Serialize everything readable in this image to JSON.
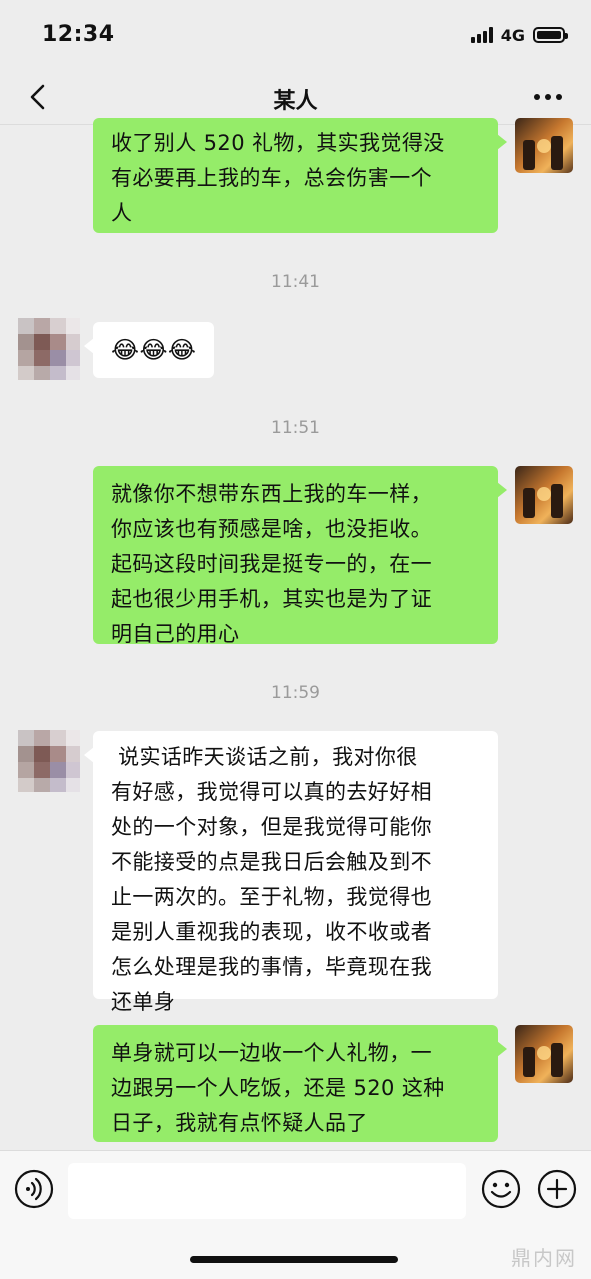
{
  "status_bar": {
    "time": "12:34",
    "network": "4G"
  },
  "nav": {
    "title": "某人"
  },
  "messages": [
    {
      "side": "out",
      "text": "收了别人 520 礼物，其实我觉得没\n有必要再上我的车，总会伤害一个\n人"
    },
    {
      "timestamp": "11:41"
    },
    {
      "side": "in",
      "text": "😂😂😂"
    },
    {
      "timestamp": "11:51"
    },
    {
      "side": "out",
      "text": "就像你不想带东西上我的车一样，\n你应该也有预感是啥，也没拒收。\n起码这段时间我是挺专一的，在一\n起也很少用手机，其实也是为了证\n明自己的用心"
    },
    {
      "timestamp": "11:59"
    },
    {
      "side": "in",
      "text": " 说实话昨天谈话之前，我对你很\n有好感，我觉得可以真的去好好相\n处的一个对象，但是我觉得可能你\n不能接受的点是我日后会触及到不\n止一两次的。至于礼物，我觉得也\n是别人重视我的表现，收不收或者\n怎么处理是我的事情，毕竟现在我\n还单身"
    },
    {
      "side": "out",
      "text": "单身就可以一边收一个人礼物，一\n边跟另一个人吃饭，还是 520 这种\n日子，我就有点怀疑人品了"
    }
  ],
  "input": {
    "value": "",
    "placeholder": ""
  },
  "icons": {
    "back": "chevron-left-icon",
    "more": "ellipsis-icon",
    "voice": "voice-icon",
    "emoji": "smiley-icon",
    "plus": "plus-icon"
  },
  "colors": {
    "outgoing_bubble": "#95ec69",
    "incoming_bubble": "#ffffff",
    "background": "#ededed"
  },
  "watermark": "鼎内网"
}
